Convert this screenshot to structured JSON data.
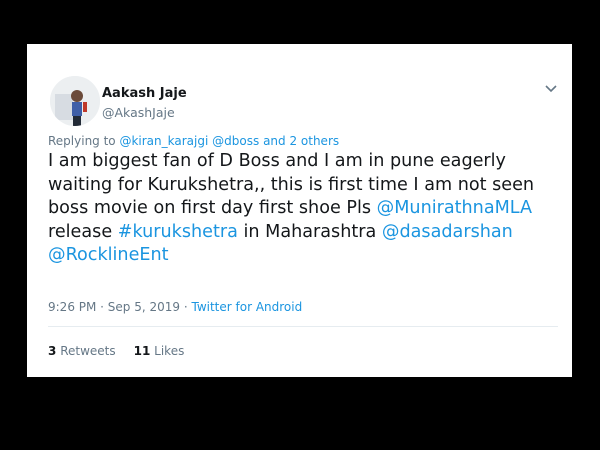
{
  "tweet": {
    "author_name": "Aakash Jaje",
    "author_handle": "@AkashJaje",
    "replying_prefix": "Replying to ",
    "reply_to_1": "@kiran_karajgi",
    "reply_to_2": "@dboss",
    "reply_to_others": "and 2 others",
    "lines": {
      "l1": "I am biggest fan of D Boss  and I am in pune eagerly",
      "l2": "waiting for Kurukshetra,, this is first time I am not seen",
      "l3_text": "boss movie on first day first shoe Pls ",
      "l3_mention": "@MunirathnaMLA",
      "l4_text1": " release ",
      "l4_hashtag": "#kurukshetra",
      "l4_text2": " in Maharashtra ",
      "l4_mention": "@dasadarshan",
      "l5_mention": "@RocklineEnt"
    },
    "timestamp": "9:26 PM · Sep 5, 2019",
    "source_separator": " · ",
    "source": "Twitter for Android",
    "retweets_count": "3",
    "retweets_label": "Retweets",
    "likes_count": "11",
    "likes_label": "Likes"
  },
  "colors": {
    "background": "#000000",
    "card": "#ffffff",
    "text": "#14171a",
    "muted": "#657786",
    "link": "#1b95e0"
  }
}
